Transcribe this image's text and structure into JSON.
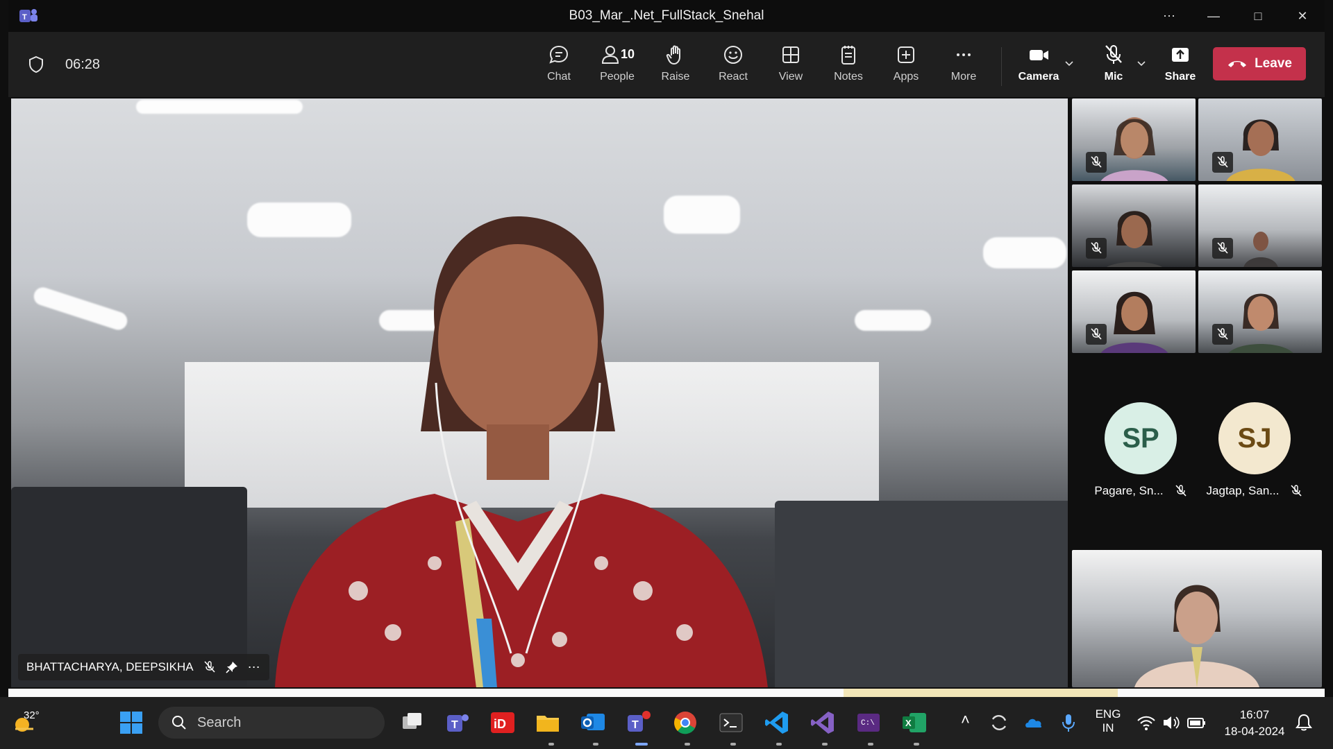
{
  "window": {
    "title": "B03_Mar_.Net_FullStack_Snehal",
    "controls": [
      "more-options",
      "minimize",
      "maximize",
      "close"
    ]
  },
  "toolbar": {
    "timer": "06:28",
    "buttons": [
      {
        "id": "chat",
        "label": "Chat",
        "icon": "chat-icon"
      },
      {
        "id": "people",
        "label": "People",
        "icon": "people-icon",
        "count": "10"
      },
      {
        "id": "raise",
        "label": "Raise",
        "icon": "hand-icon"
      },
      {
        "id": "react",
        "label": "React",
        "icon": "smiley-icon"
      },
      {
        "id": "view",
        "label": "View",
        "icon": "grid-icon"
      },
      {
        "id": "notes",
        "label": "Notes",
        "icon": "notes-icon"
      },
      {
        "id": "apps",
        "label": "Apps",
        "icon": "apps-icon"
      },
      {
        "id": "more",
        "label": "More",
        "icon": "ellipsis-icon"
      },
      {
        "id": "camera",
        "label": "Camera",
        "icon": "camera-icon"
      },
      {
        "id": "mic",
        "label": "Mic",
        "icon": "mic-off-icon"
      },
      {
        "id": "share",
        "label": "Share",
        "icon": "share-icon"
      }
    ],
    "leave_label": "Leave",
    "leave_color": "#c4314b"
  },
  "main_video": {
    "participant_name": "BHATTACHARYA, DEEPSIKHA",
    "muted": true
  },
  "gallery": {
    "video_tiles_muted": [
      true,
      true,
      true,
      true,
      true,
      true
    ],
    "avatars": [
      {
        "initials": "SP",
        "name": "Pagare, Sn...",
        "bg": "#d9efe6",
        "fg": "#2b5e4a"
      },
      {
        "initials": "SJ",
        "name": "Jagtap, San...",
        "bg": "#f3e8cf",
        "fg": "#6b4a14"
      }
    ]
  },
  "taskbar": {
    "weather_temp": "32°",
    "search_placeholder": "Search",
    "language_line1": "ENG",
    "language_line2": "IN",
    "time": "16:07",
    "date": "18-04-2024"
  }
}
